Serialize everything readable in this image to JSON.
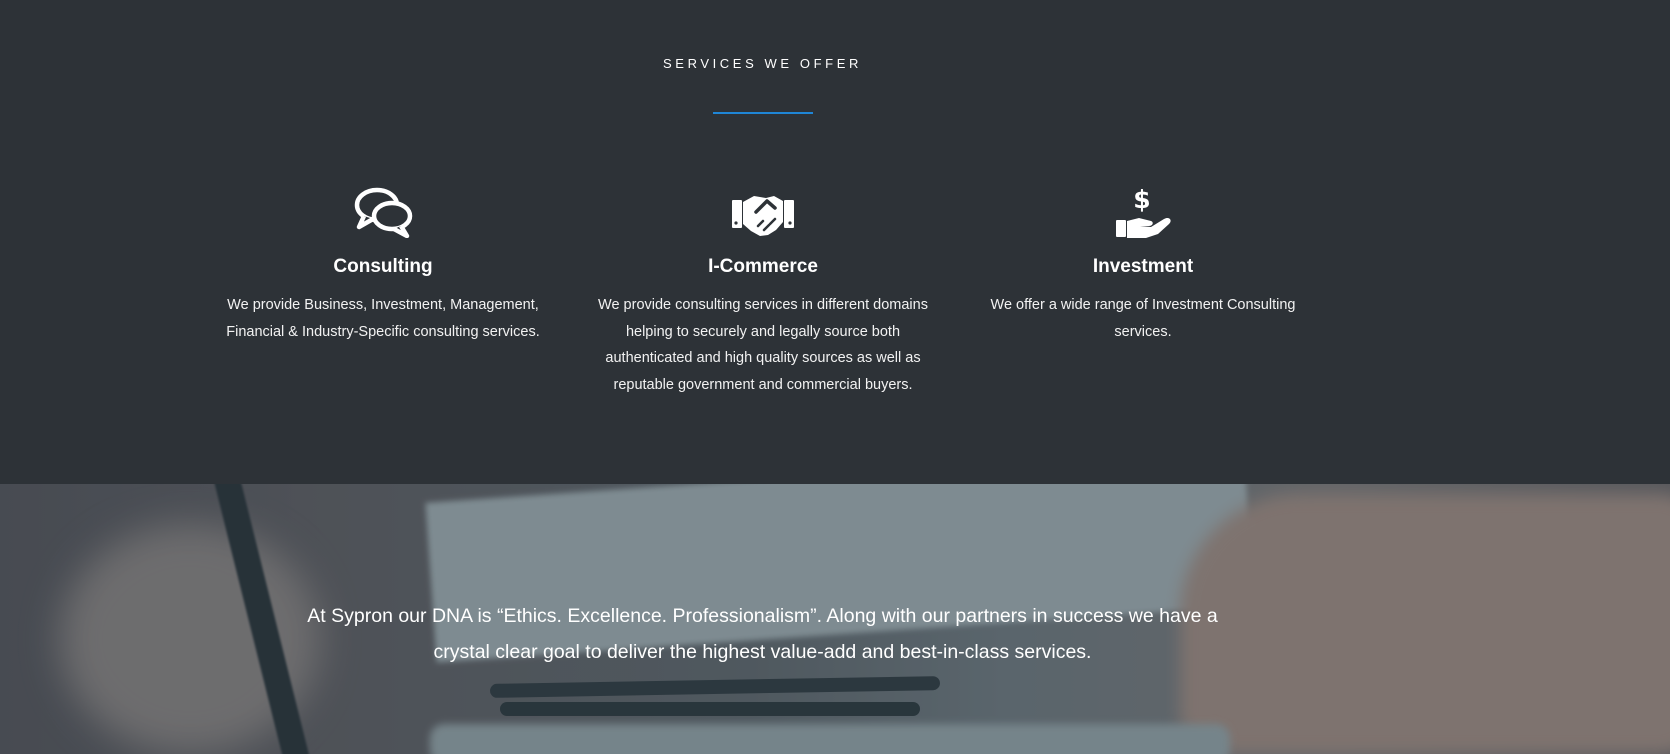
{
  "section": {
    "title": "SERVICES WE OFFER"
  },
  "services": [
    {
      "icon": "chat-bubbles-icon",
      "title": "Consulting",
      "lines": [
        "We provide Business, Investment, Management,",
        "Financial & Industry-Specific consulting services."
      ]
    },
    {
      "icon": "handshake-icon",
      "title": "I-Commerce",
      "lines": [
        "We provide consulting services in different domains",
        "helping to securely and legally source both",
        "authenticated and high quality sources as well as",
        "reputable government and commercial buyers."
      ]
    },
    {
      "icon": "hand-holding-dollar-icon",
      "title": "Investment",
      "lines": [
        "We offer a wide range of Investment Consulting",
        "services."
      ]
    }
  ],
  "banner": {
    "line1": "At Sypron our DNA is “Ethics. Excellence. Professionalism”.  Along with our partners in success we have a",
    "line2": "crystal clear goal to deliver the highest value-add and best-in-class services."
  },
  "colors": {
    "background": "#2d3237",
    "accent": "#1f86d6",
    "text": "#ffffff"
  }
}
